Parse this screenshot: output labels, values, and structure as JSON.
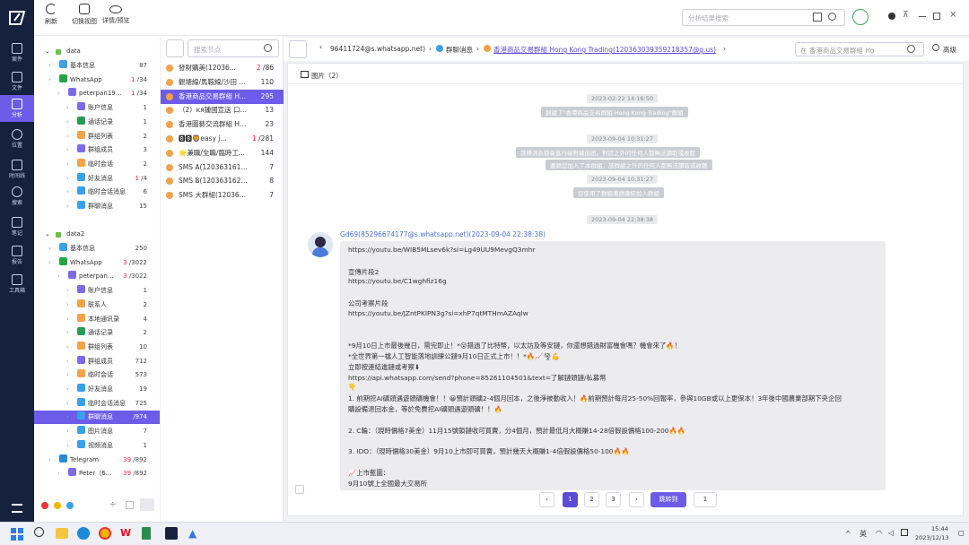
{
  "toolbar": {
    "refresh": "刷新",
    "switch_view": "切换视图",
    "details_preview": "详情/预览",
    "global_search_placeholder": "分析结果搜索"
  },
  "rail": [
    "案件",
    "文件",
    "分析",
    "位置",
    "时间线",
    "搜索",
    "笔记",
    "报告",
    "工具箱"
  ],
  "tree": {
    "data1": {
      "label": "data",
      "rows": [
        {
          "label": "基本信息",
          "count": "87"
        },
        {
          "label": "WhatsApp",
          "count_red": "1",
          "count": "/34"
        },
        {
          "label": "peterpan19...",
          "count_red": "1",
          "count": "/34"
        },
        {
          "label": "账户信息",
          "count": "1"
        },
        {
          "label": "通话记录",
          "count": "1"
        },
        {
          "label": "群组列表",
          "count": "2"
        },
        {
          "label": "群组成员",
          "count": "3"
        },
        {
          "label": "临时会话",
          "count": "2"
        },
        {
          "label": "好友消息",
          "count_red": "1",
          "count": "/4"
        },
        {
          "label": "临时会话消息",
          "count": "6"
        },
        {
          "label": "群聊消息",
          "count": "15"
        }
      ]
    },
    "data2": {
      "label": "data2",
      "rows": [
        {
          "label": "基本信息",
          "count": "250"
        },
        {
          "label": "WhatsApp",
          "count_red": "3",
          "count": "/3022"
        },
        {
          "label": "peterpan...",
          "count_red": "3",
          "count": "/3022"
        },
        {
          "label": "账户信息",
          "count": "1"
        },
        {
          "label": "联系人",
          "count": "2"
        },
        {
          "label": "本地通讯录",
          "count": "4"
        },
        {
          "label": "通话记录",
          "count": "2"
        },
        {
          "label": "群组列表",
          "count": "10"
        },
        {
          "label": "群组成员",
          "count": "712"
        },
        {
          "label": "临时会话",
          "count": "573"
        },
        {
          "label": "好友消息",
          "count": "19"
        },
        {
          "label": "临时会话消息",
          "count": "725"
        },
        {
          "label": "群聊消息",
          "count": "/974"
        },
        {
          "label": "图片消息",
          "count": "7"
        },
        {
          "label": "视频消息",
          "count": "1"
        },
        {
          "label": "Telegram",
          "count_red": "39",
          "count": "/892"
        },
        {
          "label": "Peter（6...",
          "count_red": "39",
          "count": "/892"
        }
      ]
    }
  },
  "threads": {
    "search_placeholder": "搜索节点",
    "items": [
      {
        "name": "發財購美(12036...",
        "count_red": "2",
        "count": "/86"
      },
      {
        "name": "觀塘線/馬鞍線/沙田 ...",
        "count": "110"
      },
      {
        "name": "香港商品交易群組 H...",
        "count": "295"
      },
      {
        "name": "（2）ĸя鍾國宣送 口富...",
        "count": "13"
      },
      {
        "name": "香港圖藝交流群組 Ho...",
        "count": "23"
      },
      {
        "name": "🅱🅱🦁easy j...",
        "count_red": "1",
        "count": "/281"
      },
      {
        "name": "🌟兼職/全職/臨時工...",
        "count": "144"
      },
      {
        "name": "SMS A(12036316107...",
        "count": "7"
      },
      {
        "name": "SMS B(12036316257...",
        "count": "8"
      },
      {
        "name": "SMS 大群組(1203631...",
        "count": "7"
      }
    ]
  },
  "breadcrumb": {
    "c1": "96411724@s.whatsapp.net)",
    "c2": "群聊消息",
    "c3": "香港商品交易群組 Hong Kong Trading(120363039359218357@g.us)",
    "search_placeholder": "在 香港商品交易群組 Ho",
    "advanced": "高级"
  },
  "panel": {
    "images_tab": "图片（2）",
    "ts1": "2023-02-22 14:16:50",
    "sys1": "創建了\"香港商品交易群組 Hong Kong Trading\"群組",
    "ts2": "2023-09-04 10:31:27",
    "sys2": "該條消息都會進行端對端加密。對話之外的任何人都無法讀取或收聽",
    "sys3": "邀請您加入了本群組，該群組之外的任何人都無法讀取或收聽",
    "ts3": "2023-09-04 10:31:27",
    "sys4": "您使用了群組邀請連結加入群組",
    "ts4": "2023-09-04 22:38:38",
    "sender": "Gd69(85296674177@s.whatsapp.net)(2023-09-04 22:38:38)",
    "lines": [
      "https://youtu.be/WIB5MLsev6k?si=Lg49UU9MevgQ3mhr",
      "",
      "宣傳片段2",
      "https://youtu.be/C1wghfiz16g",
      "",
      "公司考察片段",
      "https://youtu.be/JZntPKIPN3g?si=xhP7qtMTHmAZAqlw",
      "",
      "",
      "*9月10日上市最後幾日，需完即止！*😮錯過了比特幣，以太坊及等安鏈，你還想錯過財富機會嗎？機會來了🔥！",
      "*全世界第一檔人工智能落地訓練公鏈9月10日正式上市！！*🔥📈🌪💪",
      "立即按連結進鏈或考察⬇",
      "https://api.whatsapp.com/send?phone=85261104501&text=了解鏈頭鏈/私募幣",
      "👇",
      "1. 前期挖AI礦頭遇遊頭礦機會！！😀預計頭礦2-4個月回本，之後淨被動收入！🔥前期預計每月25-50%回報率，參與10GB或以上更保本！3年後中國農業部期下央企回",
      "購設備退回本金，等於免費挖AI礦頭遇遊頭礦！！🔥",
      "",
      "2. C輪：（現時價格7美金）11月15號鎖鏈收可買賣，分4個月，預計最低月大概賺14-28倍假設價格100-200🔥🔥",
      "",
      "3. IDO：（現時價格30美金）9月10上市即可買賣，預計幾天大概賺1-4倍假設價格50-100🔥🔥",
      "",
      "📈上市藍圖：",
      "9月10號上全國最大交易所"
    ]
  },
  "pagination": {
    "p1": "1",
    "p2": "2",
    "p3": "3",
    "jump": "跳转到",
    "jump_value": "1"
  },
  "taskbar": {
    "ime": "英",
    "time": "15:44",
    "date": "2023/12/13"
  }
}
